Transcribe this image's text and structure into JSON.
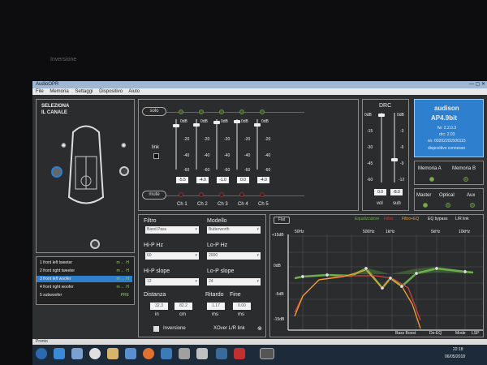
{
  "window": {
    "title": "AudioOPR",
    "menu": [
      "File",
      "Memoria",
      "Settaggi",
      "Dispositivo",
      "Aiuto"
    ]
  },
  "background_label": "Inversione",
  "channel_select": {
    "title_line1": "SELEZIONA",
    "title_line2": "IL CANALE"
  },
  "mixer": {
    "solo_label": "solo",
    "mute_label": "mute",
    "link_label": "link",
    "scale": [
      "0dB",
      "-20",
      "-40",
      "-60"
    ],
    "channels": [
      {
        "name": "Ch 1",
        "value": "-5.5"
      },
      {
        "name": "Ch 2",
        "value": "-4.0"
      },
      {
        "name": "Ch 3",
        "value": "-1.0"
      },
      {
        "name": "Ch 4",
        "value": "0.0"
      },
      {
        "name": "Ch 5",
        "value": "-4.0"
      }
    ]
  },
  "drc": {
    "title": "DRC",
    "vol_scale": [
      "0dB",
      "-15",
      "-30",
      "-45",
      "-60"
    ],
    "sub_scale": [
      "0dB",
      "-3",
      "-6",
      "-9",
      "-12"
    ],
    "vol_value": "0.0",
    "sub_value": "-8.0",
    "vol_label": "vol",
    "sub_label": "sub"
  },
  "device": {
    "brand": "audison",
    "model": "AP4.9bit",
    "fw": "fw: 2.2.0.3",
    "drc": "drc: 2.03",
    "sn": "sn: 00202201500115",
    "status": "dispositivo connesso"
  },
  "memory": {
    "a": "Memoria A",
    "b": "Memoria B",
    "sources": [
      "Master",
      "Optical",
      "Aux"
    ]
  },
  "channel_list": [
    {
      "num": "1",
      "name": "front left tweeter",
      "tag": "m ← H"
    },
    {
      "num": "2",
      "name": "front right tweeter",
      "tag": "m ← H"
    },
    {
      "num": "3",
      "name": "front left woofer",
      "tag": "m ← H"
    },
    {
      "num": "4",
      "name": "front right woofer",
      "tag": "m ← H"
    },
    {
      "num": "5",
      "name": "subwoofer",
      "tag": "PRE"
    }
  ],
  "filter": {
    "filtro_label": "Filtro",
    "filtro_value": "Band Pass",
    "modello_label": "Modello",
    "modello_value": "Butterworth",
    "hip_label": "Hi-P Hz",
    "hip_value": "60",
    "lop_label": "Lo-P Hz",
    "lop_value": "2000",
    "hips_label": "Hi-P slope",
    "hips_value": "12",
    "lops_label": "Lo-P slope",
    "lops_value": "24",
    "distanza_label": "Distanza",
    "dist_in": "32.3",
    "dist_cm": "82.2",
    "ritardo_label": "Ritardo",
    "ritardo_value": "1.17",
    "fine_label": "Fine",
    "fine_value": "0.00",
    "u_in": "in",
    "u_cm": "cm",
    "u_ms": "ms",
    "u_ms2": "ms",
    "inversione": "Inversione",
    "xover": "XOver L/R link"
  },
  "eq": {
    "tab": "Flat",
    "legend": [
      "Equalizzatore",
      "Filtro",
      "Filtro+EQ",
      "EQ bypass",
      "L/R link"
    ],
    "y_labels": [
      "+15dB",
      "0dB",
      "-5dB",
      "-15dB"
    ],
    "x_labels": [
      "50Hz",
      "500Hz",
      "1kHz",
      "5kHz",
      "10kHz"
    ],
    "footer": [
      "Bass Boost",
      "De-EQ",
      "Mode",
      "LSP"
    ]
  },
  "status": {
    "left": "Pronto"
  },
  "clock": {
    "time": "22:18",
    "date": "06/05/2018"
  },
  "colors": {
    "accent": "#2f7fcf",
    "eq_green": "#6ab04c",
    "eq_orange": "#f0a030",
    "eq_red": "#d04040"
  }
}
